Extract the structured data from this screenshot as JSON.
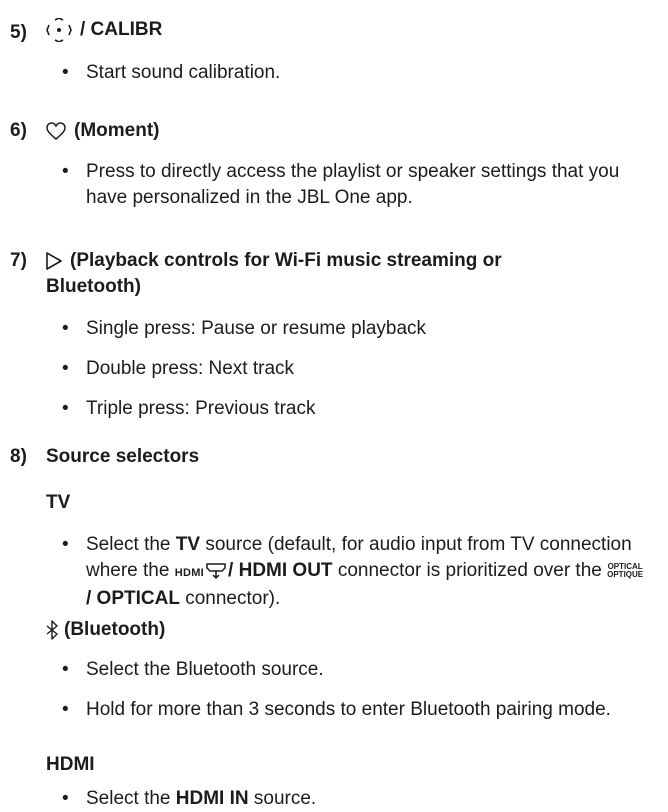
{
  "s5": {
    "num": "5)",
    "title": "/ CALIBR",
    "b1": "Start sound calibration."
  },
  "s6": {
    "num": "6)",
    "title": "(Moment)",
    "b1": "Press to directly access the playlist or speaker settings that you have personalized in the JBL One app."
  },
  "s7": {
    "num": "7)",
    "title_l1": "(Playback controls for Wi-Fi music streaming or",
    "title_l2": "Bluetooth)",
    "b1": "Single press: Pause or resume playback",
    "b2": "Double press: Next track",
    "b3": "Triple press: Previous track"
  },
  "s8": {
    "num": "8)",
    "title": "Source selectors",
    "tv": {
      "heading": "TV",
      "b1_pre": "Select the ",
      "b1_bold": "TV",
      "b1_post1": " source (default, for audio input from TV connection where the ",
      "hdmi_icon_text": "HDMI",
      "hdmi_out": "/ HDMI OUT",
      "b1_post2": " connector is prioritized over the ",
      "optical_l1": "OPTICAL",
      "optical_l2": "OPTIQUE",
      "optical_bold": "/ OPTICAL",
      "b1_end": " connector)."
    },
    "bt": {
      "heading": "(Bluetooth)",
      "b1": "Select the Bluetooth source.",
      "b2": "Hold for more than 3 seconds to enter Bluetooth pairing mode."
    },
    "hdmi": {
      "heading": "HDMI",
      "b1_pre": "Select the ",
      "b1_bold": "HDMI IN",
      "b1_post": " source."
    }
  },
  "icons": [
    "calibration-icon",
    "heart-icon",
    "play-icon",
    "bluetooth-icon",
    "hdmi-arc-icon"
  ]
}
